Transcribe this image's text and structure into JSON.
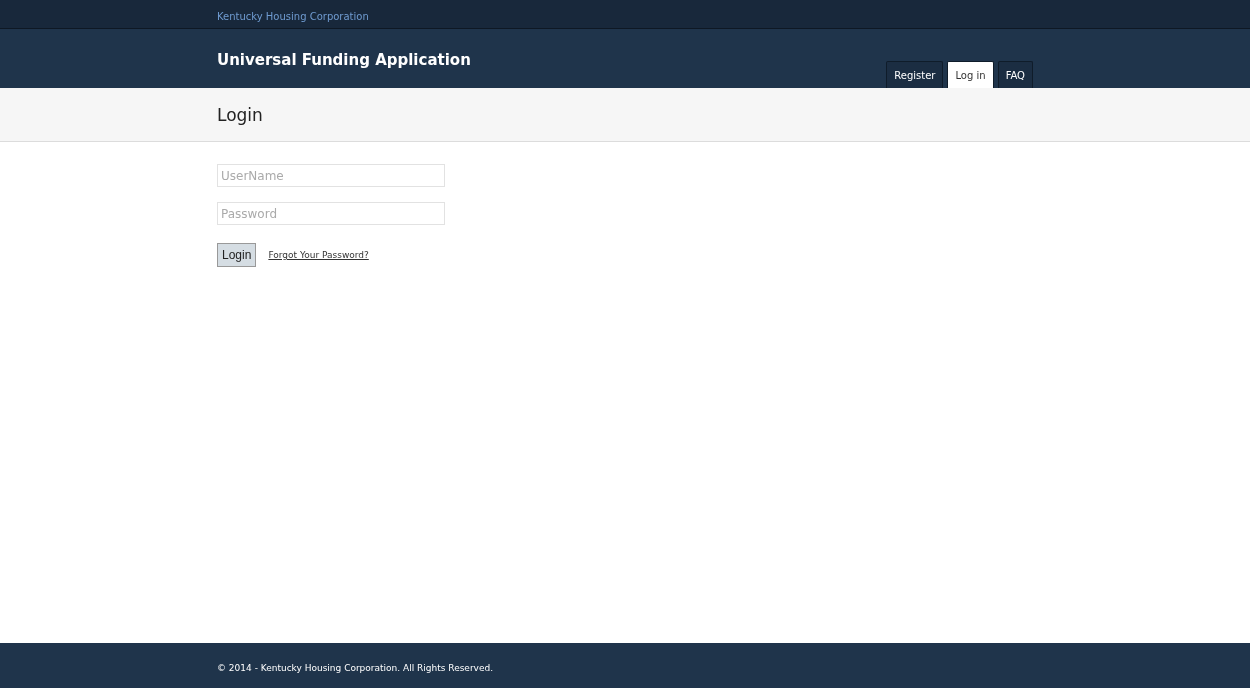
{
  "top_bar": {
    "organization": "Kentucky Housing Corporation"
  },
  "header": {
    "title": "Universal Funding Application"
  },
  "tabs": [
    {
      "label": "Register",
      "selected": false
    },
    {
      "label": "Log in",
      "selected": true
    },
    {
      "label": "FAQ",
      "selected": false
    }
  ],
  "page": {
    "heading": "Login"
  },
  "form": {
    "username": {
      "placeholder": "UserName"
    },
    "password": {
      "placeholder": "Password"
    },
    "submit": "Login",
    "forgot_link": "Forgot Your Password?"
  },
  "footer": {
    "text": "© 2014 - Kentucky Housing Corporation. All Rights Reserved."
  }
}
